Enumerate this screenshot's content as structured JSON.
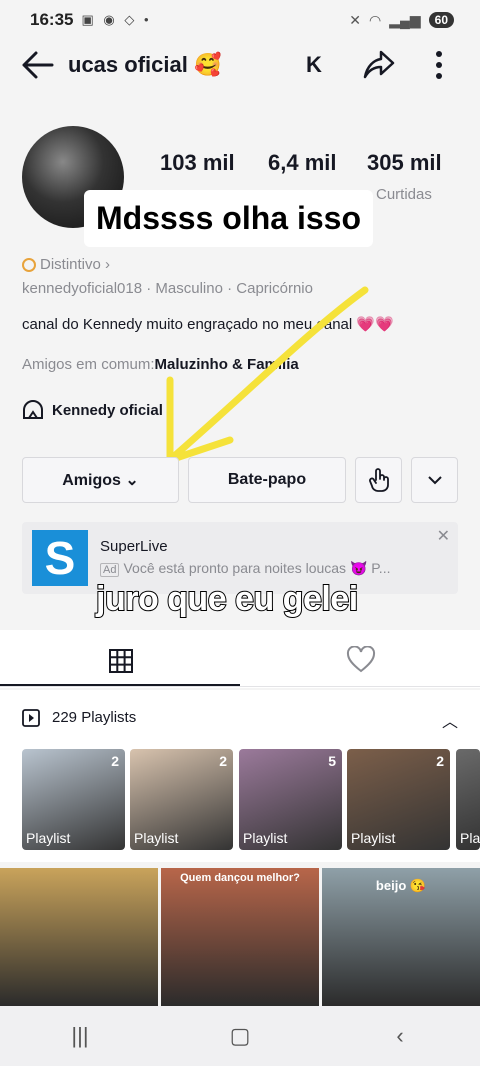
{
  "status_bar": {
    "time": "16:35",
    "notif_icons": "▣ ◉ ◇ •",
    "battery": "60"
  },
  "header": {
    "title": "ucas oficial 🥰",
    "title_fragment": "K"
  },
  "stats": [
    {
      "value": "103 mil",
      "label": ""
    },
    {
      "value": "6,4 mil",
      "label": ""
    },
    {
      "value": "305 mil",
      "label": "Curtidas"
    }
  ],
  "overlay_text_top": "Mdssss olha isso",
  "badge": "Distintivo ›",
  "meta": "kennedyoficial018  ·  Masculino  ·  Capricórnio",
  "bio": "canal do Kennedy muito engraçado no meu canal 💗💗",
  "friends": {
    "prefix": "Amigos em comum:",
    "names": "Maluzinho & Família"
  },
  "linked_account": "Kennedy oficial",
  "buttons": {
    "friends": "Amigos ⌄",
    "chat": "Bate-papo"
  },
  "ad": {
    "name": "SuperLive",
    "tag": "Ad",
    "description": "Você está pronto para noites loucas 😈 P..."
  },
  "overlay_text_bottom": "juro que eu gelei",
  "playlists": {
    "title": "229 Playlists",
    "items": [
      {
        "count": "2",
        "label": "Playlist",
        "color": "#b9c4cf"
      },
      {
        "count": "2",
        "label": "Playlist",
        "color": "#d8c3ae"
      },
      {
        "count": "5",
        "label": "Playlist",
        "color": "#9b7a9b"
      },
      {
        "count": "2",
        "label": "Playlist",
        "color": "#7c5f4a"
      },
      {
        "count": "",
        "label": "Pla",
        "color": "#6a6a6a"
      }
    ]
  },
  "videos": [
    {
      "caption": "",
      "color": "#c9a35b"
    },
    {
      "caption": "Quem dançou melhor?",
      "color": "#b8664a"
    },
    {
      "caption": "beijo 😘",
      "color": "#8fa0a8"
    }
  ],
  "nav": {
    "recent": "|||",
    "home": "▢",
    "back": "‹"
  }
}
